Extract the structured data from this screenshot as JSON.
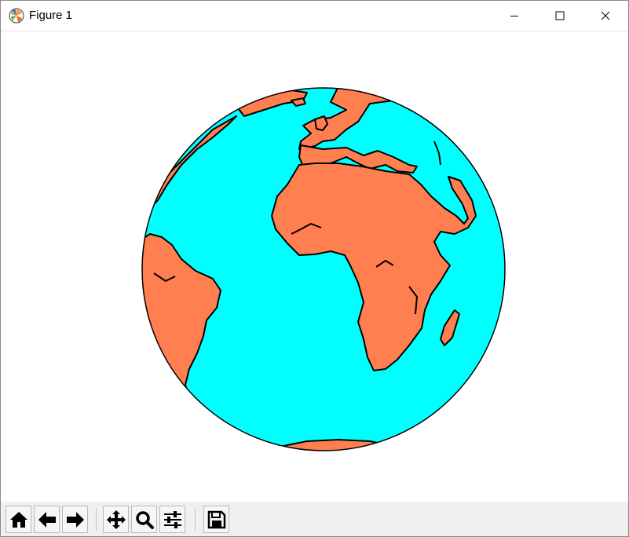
{
  "window": {
    "title": "Figure 1",
    "app_icon": "matplotlib-icon",
    "controls": [
      "minimize-icon",
      "maximize-icon",
      "close-icon"
    ]
  },
  "figure": {
    "projection": "orthographic",
    "ocean_color": "#00ffff",
    "land_color": "#ff7f50",
    "coastline_color": "#000000"
  },
  "toolbar": {
    "buttons": [
      {
        "icon": "home-icon"
      },
      {
        "icon": "back-arrow-icon"
      },
      {
        "icon": "forward-arrow-icon"
      },
      {
        "icon": "pan-icon"
      },
      {
        "icon": "zoom-icon"
      },
      {
        "icon": "configure-subplots-icon"
      },
      {
        "icon": "save-icon"
      }
    ]
  }
}
